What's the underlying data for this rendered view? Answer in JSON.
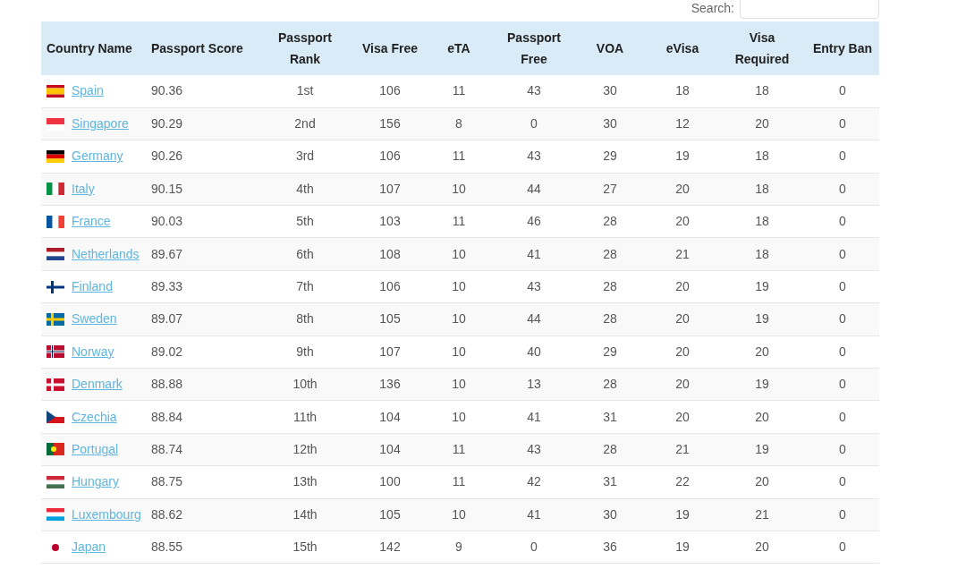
{
  "search": {
    "label": "Search:"
  },
  "table": {
    "columns": [
      "Country Name",
      "Passport Score",
      "Passport Rank",
      "Visa Free",
      "eTA",
      "Passport Free",
      "VOA",
      "eVisa",
      "Visa Required",
      "Entry Ban"
    ],
    "rows": [
      {
        "cells": [
          "Spain",
          "90.36",
          "1st",
          "106",
          "11",
          "43",
          "30",
          "18",
          "18",
          "0"
        ]
      },
      {
        "cells": [
          "Singapore",
          "90.29",
          "2nd",
          "156",
          "8",
          "0",
          "30",
          "12",
          "20",
          "0"
        ]
      },
      {
        "cells": [
          "Germany",
          "90.26",
          "3rd",
          "106",
          "11",
          "43",
          "29",
          "19",
          "18",
          "0"
        ]
      },
      {
        "cells": [
          "Italy",
          "90.15",
          "4th",
          "107",
          "10",
          "44",
          "27",
          "20",
          "18",
          "0"
        ]
      },
      {
        "cells": [
          "France",
          "90.03",
          "5th",
          "103",
          "11",
          "46",
          "28",
          "20",
          "18",
          "0"
        ]
      },
      {
        "cells": [
          "Netherlands",
          "89.67",
          "6th",
          "108",
          "10",
          "41",
          "28",
          "21",
          "18",
          "0"
        ]
      },
      {
        "cells": [
          "Finland",
          "89.33",
          "7th",
          "106",
          "10",
          "43",
          "28",
          "20",
          "19",
          "0"
        ]
      },
      {
        "cells": [
          "Sweden",
          "89.07",
          "8th",
          "105",
          "10",
          "44",
          "28",
          "20",
          "19",
          "0"
        ]
      },
      {
        "cells": [
          "Norway",
          "89.02",
          "9th",
          "107",
          "10",
          "40",
          "29",
          "20",
          "20",
          "0"
        ]
      },
      {
        "cells": [
          "Denmark",
          "88.88",
          "10th",
          "136",
          "10",
          "13",
          "28",
          "20",
          "19",
          "0"
        ]
      },
      {
        "cells": [
          "Czechia",
          "88.84",
          "11th",
          "104",
          "10",
          "41",
          "31",
          "20",
          "20",
          "0"
        ]
      },
      {
        "cells": [
          "Portugal",
          "88.74",
          "12th",
          "104",
          "11",
          "43",
          "28",
          "21",
          "19",
          "0"
        ]
      },
      {
        "cells": [
          "Hungary",
          "88.75",
          "13th",
          "100",
          "11",
          "42",
          "31",
          "22",
          "20",
          "0"
        ]
      },
      {
        "cells": [
          "Luxembourg",
          "88.62",
          "14th",
          "105",
          "10",
          "41",
          "30",
          "19",
          "21",
          "0"
        ]
      },
      {
        "cells": [
          "Japan",
          "88.55",
          "15th",
          "142",
          "9",
          "0",
          "36",
          "19",
          "20",
          "0"
        ]
      }
    ]
  }
}
